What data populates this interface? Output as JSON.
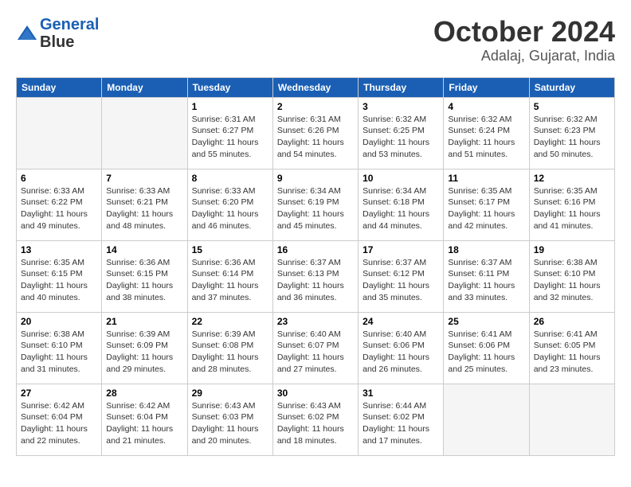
{
  "header": {
    "logo_line1": "General",
    "logo_line2": "Blue",
    "title": "October 2024",
    "subtitle": "Adalaj, Gujarat, India"
  },
  "weekdays": [
    "Sunday",
    "Monday",
    "Tuesday",
    "Wednesday",
    "Thursday",
    "Friday",
    "Saturday"
  ],
  "weeks": [
    [
      {
        "day": null,
        "info": null
      },
      {
        "day": null,
        "info": null
      },
      {
        "day": "1",
        "info": "Sunrise: 6:31 AM\nSunset: 6:27 PM\nDaylight: 11 hours and 55 minutes."
      },
      {
        "day": "2",
        "info": "Sunrise: 6:31 AM\nSunset: 6:26 PM\nDaylight: 11 hours and 54 minutes."
      },
      {
        "day": "3",
        "info": "Sunrise: 6:32 AM\nSunset: 6:25 PM\nDaylight: 11 hours and 53 minutes."
      },
      {
        "day": "4",
        "info": "Sunrise: 6:32 AM\nSunset: 6:24 PM\nDaylight: 11 hours and 51 minutes."
      },
      {
        "day": "5",
        "info": "Sunrise: 6:32 AM\nSunset: 6:23 PM\nDaylight: 11 hours and 50 minutes."
      }
    ],
    [
      {
        "day": "6",
        "info": "Sunrise: 6:33 AM\nSunset: 6:22 PM\nDaylight: 11 hours and 49 minutes."
      },
      {
        "day": "7",
        "info": "Sunrise: 6:33 AM\nSunset: 6:21 PM\nDaylight: 11 hours and 48 minutes."
      },
      {
        "day": "8",
        "info": "Sunrise: 6:33 AM\nSunset: 6:20 PM\nDaylight: 11 hours and 46 minutes."
      },
      {
        "day": "9",
        "info": "Sunrise: 6:34 AM\nSunset: 6:19 PM\nDaylight: 11 hours and 45 minutes."
      },
      {
        "day": "10",
        "info": "Sunrise: 6:34 AM\nSunset: 6:18 PM\nDaylight: 11 hours and 44 minutes."
      },
      {
        "day": "11",
        "info": "Sunrise: 6:35 AM\nSunset: 6:17 PM\nDaylight: 11 hours and 42 minutes."
      },
      {
        "day": "12",
        "info": "Sunrise: 6:35 AM\nSunset: 6:16 PM\nDaylight: 11 hours and 41 minutes."
      }
    ],
    [
      {
        "day": "13",
        "info": "Sunrise: 6:35 AM\nSunset: 6:15 PM\nDaylight: 11 hours and 40 minutes."
      },
      {
        "day": "14",
        "info": "Sunrise: 6:36 AM\nSunset: 6:15 PM\nDaylight: 11 hours and 38 minutes."
      },
      {
        "day": "15",
        "info": "Sunrise: 6:36 AM\nSunset: 6:14 PM\nDaylight: 11 hours and 37 minutes."
      },
      {
        "day": "16",
        "info": "Sunrise: 6:37 AM\nSunset: 6:13 PM\nDaylight: 11 hours and 36 minutes."
      },
      {
        "day": "17",
        "info": "Sunrise: 6:37 AM\nSunset: 6:12 PM\nDaylight: 11 hours and 35 minutes."
      },
      {
        "day": "18",
        "info": "Sunrise: 6:37 AM\nSunset: 6:11 PM\nDaylight: 11 hours and 33 minutes."
      },
      {
        "day": "19",
        "info": "Sunrise: 6:38 AM\nSunset: 6:10 PM\nDaylight: 11 hours and 32 minutes."
      }
    ],
    [
      {
        "day": "20",
        "info": "Sunrise: 6:38 AM\nSunset: 6:10 PM\nDaylight: 11 hours and 31 minutes."
      },
      {
        "day": "21",
        "info": "Sunrise: 6:39 AM\nSunset: 6:09 PM\nDaylight: 11 hours and 29 minutes."
      },
      {
        "day": "22",
        "info": "Sunrise: 6:39 AM\nSunset: 6:08 PM\nDaylight: 11 hours and 28 minutes."
      },
      {
        "day": "23",
        "info": "Sunrise: 6:40 AM\nSunset: 6:07 PM\nDaylight: 11 hours and 27 minutes."
      },
      {
        "day": "24",
        "info": "Sunrise: 6:40 AM\nSunset: 6:06 PM\nDaylight: 11 hours and 26 minutes."
      },
      {
        "day": "25",
        "info": "Sunrise: 6:41 AM\nSunset: 6:06 PM\nDaylight: 11 hours and 25 minutes."
      },
      {
        "day": "26",
        "info": "Sunrise: 6:41 AM\nSunset: 6:05 PM\nDaylight: 11 hours and 23 minutes."
      }
    ],
    [
      {
        "day": "27",
        "info": "Sunrise: 6:42 AM\nSunset: 6:04 PM\nDaylight: 11 hours and 22 minutes."
      },
      {
        "day": "28",
        "info": "Sunrise: 6:42 AM\nSunset: 6:04 PM\nDaylight: 11 hours and 21 minutes."
      },
      {
        "day": "29",
        "info": "Sunrise: 6:43 AM\nSunset: 6:03 PM\nDaylight: 11 hours and 20 minutes."
      },
      {
        "day": "30",
        "info": "Sunrise: 6:43 AM\nSunset: 6:02 PM\nDaylight: 11 hours and 18 minutes."
      },
      {
        "day": "31",
        "info": "Sunrise: 6:44 AM\nSunset: 6:02 PM\nDaylight: 11 hours and 17 minutes."
      },
      {
        "day": null,
        "info": null
      },
      {
        "day": null,
        "info": null
      }
    ]
  ]
}
